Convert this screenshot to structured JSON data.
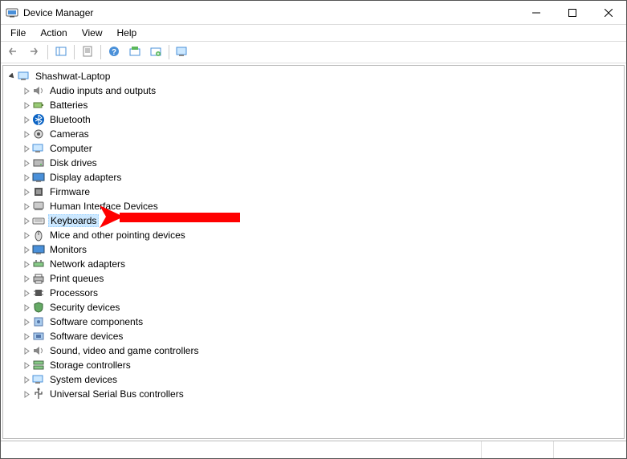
{
  "window": {
    "title": "Device Manager"
  },
  "menubar": {
    "items": [
      {
        "label": "File"
      },
      {
        "label": "Action"
      },
      {
        "label": "View"
      },
      {
        "label": "Help"
      }
    ]
  },
  "toolbar": {
    "icons": [
      "back-icon",
      "forward-icon",
      "sep",
      "show-hide-tree-icon",
      "sep",
      "properties-icon",
      "sep",
      "help-icon",
      "update-icon",
      "uninstall-icon",
      "sep",
      "scan-hardware-icon"
    ]
  },
  "tree": {
    "root": {
      "label": "Shashwat-Laptop",
      "icon": "computer-icon",
      "expanded": true
    },
    "nodes": [
      {
        "label": "Audio inputs and outputs",
        "icon": "audio-icon"
      },
      {
        "label": "Batteries",
        "icon": "battery-icon"
      },
      {
        "label": "Bluetooth",
        "icon": "bluetooth-icon"
      },
      {
        "label": "Cameras",
        "icon": "camera-icon"
      },
      {
        "label": "Computer",
        "icon": "computer-icon"
      },
      {
        "label": "Disk drives",
        "icon": "disk-icon"
      },
      {
        "label": "Display adapters",
        "icon": "display-icon"
      },
      {
        "label": "Firmware",
        "icon": "firmware-icon"
      },
      {
        "label": "Human Interface Devices",
        "icon": "hid-icon"
      },
      {
        "label": "Keyboards",
        "icon": "keyboard-icon",
        "selected": true
      },
      {
        "label": "Mice and other pointing devices",
        "icon": "mouse-icon"
      },
      {
        "label": "Monitors",
        "icon": "monitor-icon"
      },
      {
        "label": "Network adapters",
        "icon": "network-icon"
      },
      {
        "label": "Print queues",
        "icon": "printer-icon"
      },
      {
        "label": "Processors",
        "icon": "cpu-icon"
      },
      {
        "label": "Security devices",
        "icon": "security-icon"
      },
      {
        "label": "Software components",
        "icon": "software-icon"
      },
      {
        "label": "Software devices",
        "icon": "software-device-icon"
      },
      {
        "label": "Sound, video and game controllers",
        "icon": "sound-icon"
      },
      {
        "label": "Storage controllers",
        "icon": "storage-icon"
      },
      {
        "label": "System devices",
        "icon": "system-icon"
      },
      {
        "label": "Universal Serial Bus controllers",
        "icon": "usb-icon"
      }
    ]
  },
  "annotation": {
    "arrow_color": "#ff0000",
    "target_node_index": 9
  }
}
